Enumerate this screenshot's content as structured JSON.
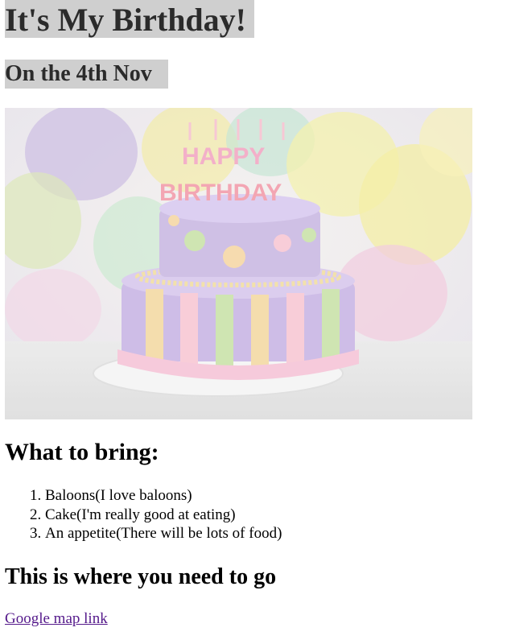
{
  "header": {
    "title": "It's My Birthday!",
    "date": "On the 4th Nov"
  },
  "hero_image": {
    "description_icon": "birthday-cake-image",
    "cake_text_top": "HAPPY",
    "cake_text_bottom": "BIRTHDAY"
  },
  "bring": {
    "heading": "What to bring:",
    "items": [
      "Baloons(I love baloons)",
      "Cake(I'm really good at eating)",
      "An appetite(There will be lots of food)"
    ]
  },
  "where": {
    "heading": "This is where you need to go",
    "link_label": "Google map link"
  },
  "colors": {
    "heading_bg": "#cfcfcf",
    "link": "#551a8b"
  }
}
